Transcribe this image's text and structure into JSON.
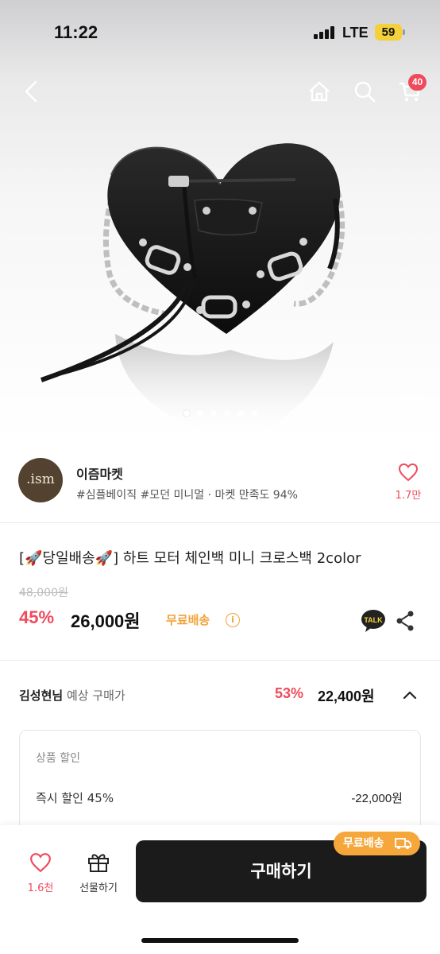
{
  "status_bar": {
    "time": "11:22",
    "network": "LTE",
    "battery": "59"
  },
  "header": {
    "icons": {
      "back": "back-icon",
      "home": "home-icon",
      "search": "search-icon",
      "cart": "cart-icon"
    },
    "cart_count": "40"
  },
  "gallery": {
    "image": "heart-shaped black leather chain crossbody bag",
    "page_count": 6,
    "current_page": 1
  },
  "store": {
    "logo_text": ".ism",
    "name": "이즘마켓",
    "tags": "#심플베이직 #모던 미니멀 · 마켓 만족도 94%",
    "like_count": "1.7만"
  },
  "product": {
    "title": "[🚀당일배송🚀] 하트 모터 체인백 미니 크로스백 2color",
    "original_price": "48,000원",
    "discount_rate": "45%",
    "price": "26,000원",
    "free_shipping": "무료배송",
    "talk_label": "TALK"
  },
  "expected_price": {
    "user_name": "김성현님",
    "label": "예상 구매가",
    "discount_rate": "53%",
    "price": "22,400원",
    "breakdown": {
      "header": "상품 할인",
      "rows": [
        {
          "label": "즉시 할인 45%",
          "value": "-22,000원"
        }
      ]
    }
  },
  "bottom_bar": {
    "like_count": "1.6천",
    "gift_label": "선물하기",
    "buy_label": "구매하기",
    "ship_badge": "무료배송"
  },
  "colors": {
    "accent": "#ef4b5c",
    "shipping": "#f0a33a",
    "buy_button": "#1b1b1b"
  }
}
